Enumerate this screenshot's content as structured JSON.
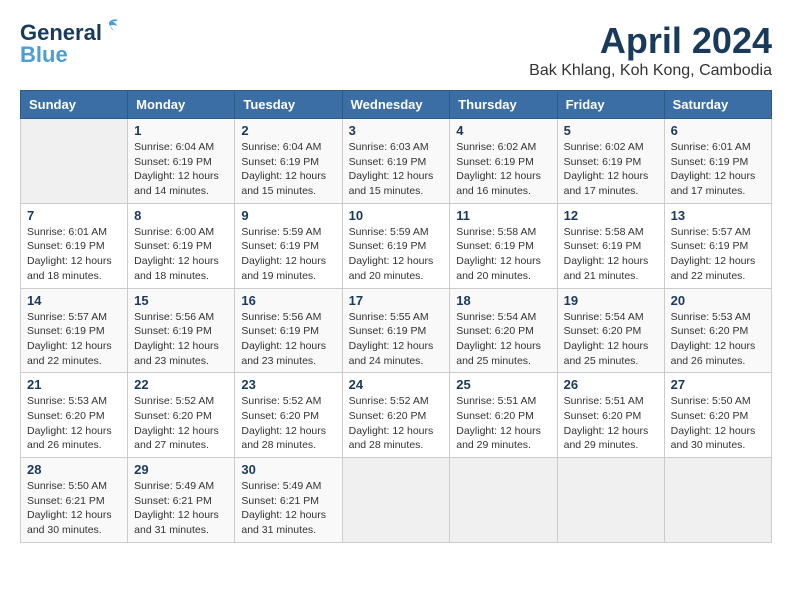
{
  "logo": {
    "line1": "General",
    "line2": "Blue"
  },
  "title": "April 2024",
  "location": "Bak Khlang, Koh Kong, Cambodia",
  "header_days": [
    "Sunday",
    "Monday",
    "Tuesday",
    "Wednesday",
    "Thursday",
    "Friday",
    "Saturday"
  ],
  "weeks": [
    [
      {
        "day": "",
        "info": ""
      },
      {
        "day": "1",
        "info": "Sunrise: 6:04 AM\nSunset: 6:19 PM\nDaylight: 12 hours\nand 14 minutes."
      },
      {
        "day": "2",
        "info": "Sunrise: 6:04 AM\nSunset: 6:19 PM\nDaylight: 12 hours\nand 15 minutes."
      },
      {
        "day": "3",
        "info": "Sunrise: 6:03 AM\nSunset: 6:19 PM\nDaylight: 12 hours\nand 15 minutes."
      },
      {
        "day": "4",
        "info": "Sunrise: 6:02 AM\nSunset: 6:19 PM\nDaylight: 12 hours\nand 16 minutes."
      },
      {
        "day": "5",
        "info": "Sunrise: 6:02 AM\nSunset: 6:19 PM\nDaylight: 12 hours\nand 17 minutes."
      },
      {
        "day": "6",
        "info": "Sunrise: 6:01 AM\nSunset: 6:19 PM\nDaylight: 12 hours\nand 17 minutes."
      }
    ],
    [
      {
        "day": "7",
        "info": "Sunrise: 6:01 AM\nSunset: 6:19 PM\nDaylight: 12 hours\nand 18 minutes."
      },
      {
        "day": "8",
        "info": "Sunrise: 6:00 AM\nSunset: 6:19 PM\nDaylight: 12 hours\nand 18 minutes."
      },
      {
        "day": "9",
        "info": "Sunrise: 5:59 AM\nSunset: 6:19 PM\nDaylight: 12 hours\nand 19 minutes."
      },
      {
        "day": "10",
        "info": "Sunrise: 5:59 AM\nSunset: 6:19 PM\nDaylight: 12 hours\nand 20 minutes."
      },
      {
        "day": "11",
        "info": "Sunrise: 5:58 AM\nSunset: 6:19 PM\nDaylight: 12 hours\nand 20 minutes."
      },
      {
        "day": "12",
        "info": "Sunrise: 5:58 AM\nSunset: 6:19 PM\nDaylight: 12 hours\nand 21 minutes."
      },
      {
        "day": "13",
        "info": "Sunrise: 5:57 AM\nSunset: 6:19 PM\nDaylight: 12 hours\nand 22 minutes."
      }
    ],
    [
      {
        "day": "14",
        "info": "Sunrise: 5:57 AM\nSunset: 6:19 PM\nDaylight: 12 hours\nand 22 minutes."
      },
      {
        "day": "15",
        "info": "Sunrise: 5:56 AM\nSunset: 6:19 PM\nDaylight: 12 hours\nand 23 minutes."
      },
      {
        "day": "16",
        "info": "Sunrise: 5:56 AM\nSunset: 6:19 PM\nDaylight: 12 hours\nand 23 minutes."
      },
      {
        "day": "17",
        "info": "Sunrise: 5:55 AM\nSunset: 6:19 PM\nDaylight: 12 hours\nand 24 minutes."
      },
      {
        "day": "18",
        "info": "Sunrise: 5:54 AM\nSunset: 6:20 PM\nDaylight: 12 hours\nand 25 minutes."
      },
      {
        "day": "19",
        "info": "Sunrise: 5:54 AM\nSunset: 6:20 PM\nDaylight: 12 hours\nand 25 minutes."
      },
      {
        "day": "20",
        "info": "Sunrise: 5:53 AM\nSunset: 6:20 PM\nDaylight: 12 hours\nand 26 minutes."
      }
    ],
    [
      {
        "day": "21",
        "info": "Sunrise: 5:53 AM\nSunset: 6:20 PM\nDaylight: 12 hours\nand 26 minutes."
      },
      {
        "day": "22",
        "info": "Sunrise: 5:52 AM\nSunset: 6:20 PM\nDaylight: 12 hours\nand 27 minutes."
      },
      {
        "day": "23",
        "info": "Sunrise: 5:52 AM\nSunset: 6:20 PM\nDaylight: 12 hours\nand 28 minutes."
      },
      {
        "day": "24",
        "info": "Sunrise: 5:52 AM\nSunset: 6:20 PM\nDaylight: 12 hours\nand 28 minutes."
      },
      {
        "day": "25",
        "info": "Sunrise: 5:51 AM\nSunset: 6:20 PM\nDaylight: 12 hours\nand 29 minutes."
      },
      {
        "day": "26",
        "info": "Sunrise: 5:51 AM\nSunset: 6:20 PM\nDaylight: 12 hours\nand 29 minutes."
      },
      {
        "day": "27",
        "info": "Sunrise: 5:50 AM\nSunset: 6:20 PM\nDaylight: 12 hours\nand 30 minutes."
      }
    ],
    [
      {
        "day": "28",
        "info": "Sunrise: 5:50 AM\nSunset: 6:21 PM\nDaylight: 12 hours\nand 30 minutes."
      },
      {
        "day": "29",
        "info": "Sunrise: 5:49 AM\nSunset: 6:21 PM\nDaylight: 12 hours\nand 31 minutes."
      },
      {
        "day": "30",
        "info": "Sunrise: 5:49 AM\nSunset: 6:21 PM\nDaylight: 12 hours\nand 31 minutes."
      },
      {
        "day": "",
        "info": ""
      },
      {
        "day": "",
        "info": ""
      },
      {
        "day": "",
        "info": ""
      },
      {
        "day": "",
        "info": ""
      }
    ]
  ]
}
